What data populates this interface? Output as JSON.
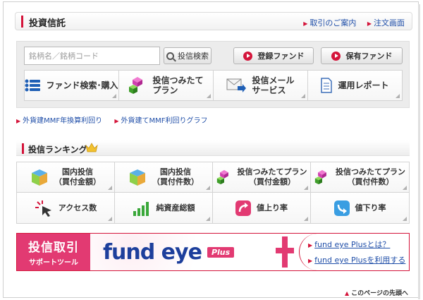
{
  "header": {
    "title": "投資信託",
    "links": [
      "取引のご案内",
      "注文画面"
    ]
  },
  "search": {
    "placeholder": "銘柄名／銘柄コード",
    "button_label": "投信検索"
  },
  "actions": {
    "registered_fund": "登録ファンド",
    "owned_fund": "保有ファンド"
  },
  "menu_tiles": [
    {
      "label": "ファンド検索･購入",
      "icon": "list-icon"
    },
    {
      "label": "投信つみたて\nプラン",
      "icon": "cube-stack-icon"
    },
    {
      "label": "投信メール\nサービス",
      "icon": "mail-arrow-icon"
    },
    {
      "label": "運用レポート",
      "icon": "document-icon"
    }
  ],
  "sub_links": [
    "外貨建MMF年換算利回り",
    "外貨建てMMF利回りグラフ"
  ],
  "ranking": {
    "title": "投信ランキング",
    "cells": [
      {
        "label": "国内投信\n（買付金額）",
        "icon": "cube-icon"
      },
      {
        "label": "国内投信\n（買付件数）",
        "icon": "cube-icon"
      },
      {
        "label": "投信つみたてプラン\n（買付金額）",
        "icon": "cube-stack-icon"
      },
      {
        "label": "投信つみたてプラン\n（買付件数）",
        "icon": "cube-stack-icon"
      },
      {
        "label": "アクセス数",
        "icon": "cursor-click-icon"
      },
      {
        "label": "純資産総額",
        "icon": "bar-chart-icon"
      },
      {
        "label": "値上り率",
        "icon": "trend-up-icon"
      },
      {
        "label": "値下り率",
        "icon": "trend-down-icon"
      }
    ]
  },
  "banner": {
    "left_title": "投信取引",
    "left_subtitle": "サポートツール",
    "logo_text": "fund eye",
    "logo_badge": "Plus",
    "links": [
      "fund eye Plusとは？",
      "fund eye Plusを利用する"
    ]
  },
  "footer": {
    "back_to_top": "このページの先頭へ"
  },
  "colors": {
    "accent_red": "#d4143a",
    "link_blue": "#1f4ea8",
    "banner_pink": "#e23a72",
    "logo_navy": "#1d3f9c"
  }
}
